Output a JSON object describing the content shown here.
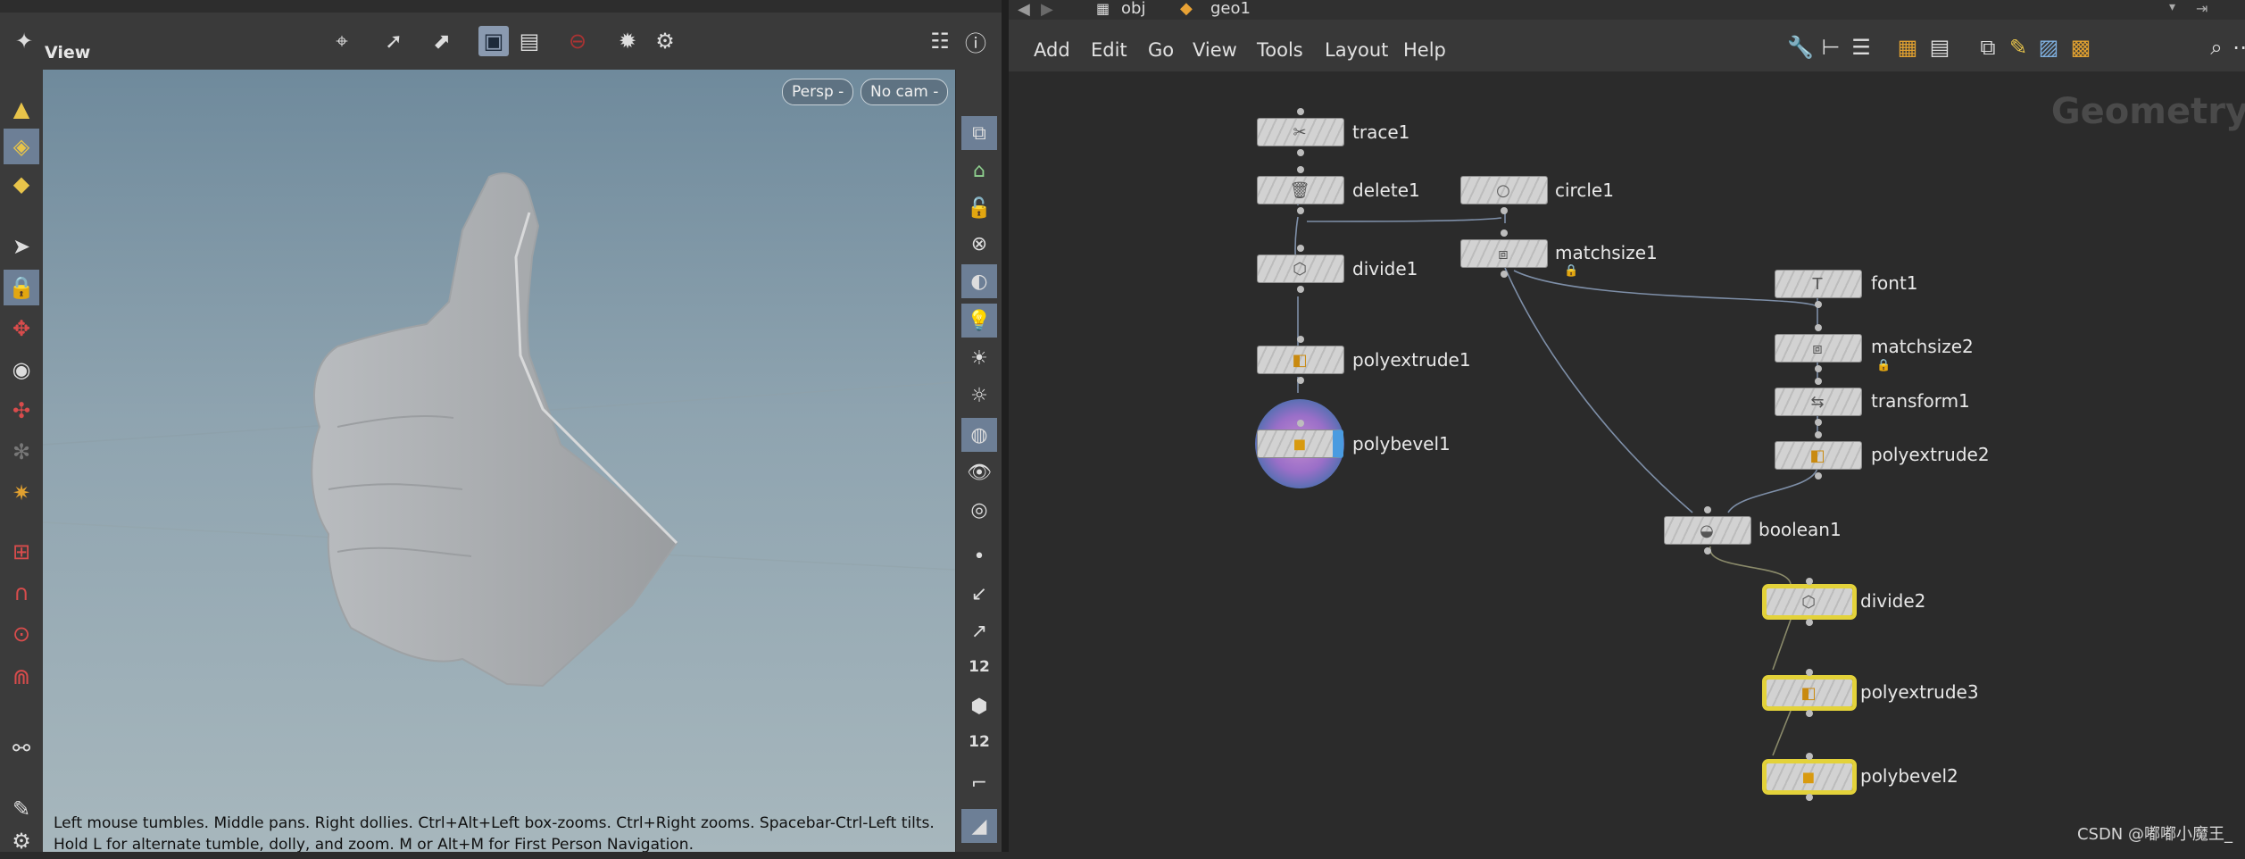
{
  "left_pane": {
    "pane_title": "View",
    "viewport": {
      "camera_projection": "Persp -",
      "camera_select": "No cam -",
      "status_lines": [
        "Left mouse tumbles. Middle pans. Right dollies. Ctrl+Alt+Left box-zooms. Ctrl+Right zooms. Spacebar-Ctrl-Left tilts.",
        "Hold L for alternate tumble, dolly, and zoom.    M or Alt+M for First Person Navigation."
      ]
    },
    "right_shelf_numbers": [
      "12",
      "12"
    ]
  },
  "network": {
    "path": [
      "obj",
      "geo1"
    ],
    "menu": [
      "Add",
      "Edit",
      "Go",
      "View",
      "Tools",
      "Layout",
      "Help"
    ],
    "context_label": "Geometry",
    "watermark": "CSDN @嘟嘟小魔王_",
    "nodes": [
      {
        "name": "trace1",
        "icon": "trace-icon"
      },
      {
        "name": "delete1",
        "icon": "delete-icon"
      },
      {
        "name": "circle1",
        "icon": "circle-icon"
      },
      {
        "name": "matchsize1",
        "icon": "matchsize-icon"
      },
      {
        "name": "divide1",
        "icon": "divide-icon"
      },
      {
        "name": "polyextrude1",
        "icon": "polyextrude-icon"
      },
      {
        "name": "polybevel1",
        "icon": "polybevel-icon"
      },
      {
        "name": "font1",
        "icon": "font-icon"
      },
      {
        "name": "matchsize2",
        "icon": "matchsize-icon"
      },
      {
        "name": "transform1",
        "icon": "transform-icon"
      },
      {
        "name": "polyextrude2",
        "icon": "polyextrude-icon"
      },
      {
        "name": "boolean1",
        "icon": "boolean-icon"
      },
      {
        "name": "divide2",
        "icon": "divide-icon"
      },
      {
        "name": "polyextrude3",
        "icon": "polyextrude-icon"
      },
      {
        "name": "polybevel2",
        "icon": "polybevel-icon"
      }
    ]
  },
  "colors": {
    "selection": "#e3d23a",
    "display_flag": "#4a7fd0",
    "wire": "#7e8fa8"
  }
}
